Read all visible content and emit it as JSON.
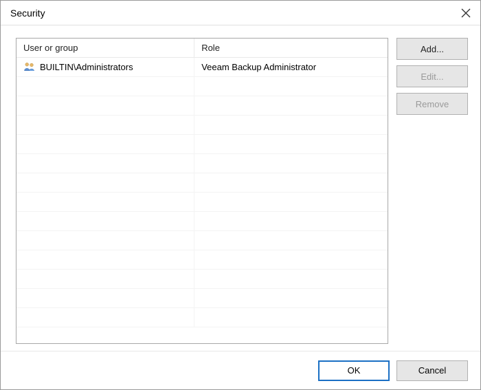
{
  "dialog": {
    "title": "Security"
  },
  "table": {
    "headers": {
      "user": "User or group",
      "role": "Role"
    },
    "rows": [
      {
        "user": "BUILTIN\\Administrators",
        "role": "Veeam Backup Administrator"
      }
    ],
    "empty_row_count": 13
  },
  "buttons": {
    "add": "Add...",
    "edit": "Edit...",
    "remove": "Remove",
    "ok": "OK",
    "cancel": "Cancel"
  }
}
